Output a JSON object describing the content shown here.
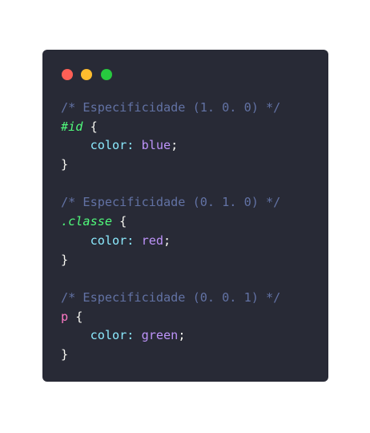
{
  "window": {
    "dots": [
      {
        "name": "close",
        "color": "#ff5f56"
      },
      {
        "name": "minimize",
        "color": "#ffbd2e"
      },
      {
        "name": "maximize",
        "color": "#27c93f"
      }
    ]
  },
  "code": {
    "block1": {
      "comment": "/* Especificidade (1. 0. 0) */",
      "selector": "#id",
      "open": " {",
      "property": "color",
      "colon": ": ",
      "value": "blue",
      "semi": ";",
      "close": "}"
    },
    "block2": {
      "comment": "/* Especificidade (0. 1. 0) */",
      "selector": ".classe",
      "open": " {",
      "property": "color",
      "colon": ": ",
      "value": "red",
      "semi": ";",
      "close": "}"
    },
    "block3": {
      "comment": "/* Especificidade (0. 0. 1) */",
      "selector": "p",
      "open": " {",
      "property": "color",
      "colon": ": ",
      "value": "green",
      "semi": ";",
      "close": "}"
    }
  }
}
